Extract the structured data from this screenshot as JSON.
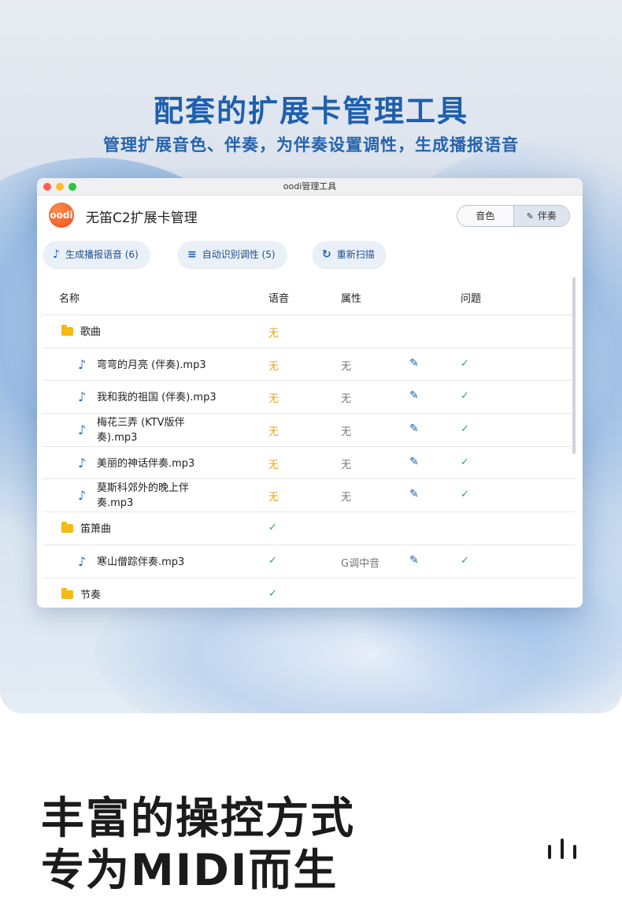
{
  "headline": "配套的扩展卡管理工具",
  "subline": "管理扩展音色、伴奏，为伴奏设置调性，生成播报语音",
  "window": {
    "title": "oodi管理工具",
    "logo_text": "oodi",
    "app_title": "无笛C2扩展卡管理",
    "tabs": [
      {
        "label": "音色"
      },
      {
        "label": "伴奏",
        "icon": "pencil-icon",
        "active": true
      }
    ],
    "toolbar": {
      "btn_voice": "生成播报语音 (6)",
      "btn_key": "自动识别调性 (5)",
      "btn_rescan": "重新扫描"
    },
    "table": {
      "headers": [
        "名称",
        "语音",
        "属性",
        "问题"
      ],
      "rows": [
        {
          "type": "folder",
          "name": "歌曲",
          "voice": "无"
        },
        {
          "type": "file",
          "name": "弯弯的月亮 (伴奏).mp3",
          "voice": "无",
          "attr": "无",
          "issue": "✓"
        },
        {
          "type": "file",
          "name": "我和我的祖国 (伴奏).mp3",
          "voice": "无",
          "attr": "无",
          "issue": "✓"
        },
        {
          "type": "file",
          "name": "梅花三弄 (KTV版伴\n奏).mp3",
          "voice": "无",
          "attr": "无",
          "issue": "✓"
        },
        {
          "type": "file",
          "name": "美丽的神话伴奏.mp3",
          "voice": "无",
          "attr": "无",
          "issue": "✓"
        },
        {
          "type": "file",
          "name": "莫斯科郊外的晚上伴\n奏.mp3",
          "voice": "无",
          "attr": "无",
          "issue": "✓"
        },
        {
          "type": "folder",
          "name": "笛箫曲",
          "voice": "✓"
        },
        {
          "type": "file",
          "name": "寒山僧踪伴奏.mp3",
          "voice": "✓",
          "attr": "G调中音",
          "issue": "✓"
        },
        {
          "type": "folder",
          "name": "节奏",
          "voice": "✓"
        }
      ]
    }
  },
  "lower": {
    "line1": "丰富的操控方式",
    "line2": "专为MIDI而生"
  }
}
